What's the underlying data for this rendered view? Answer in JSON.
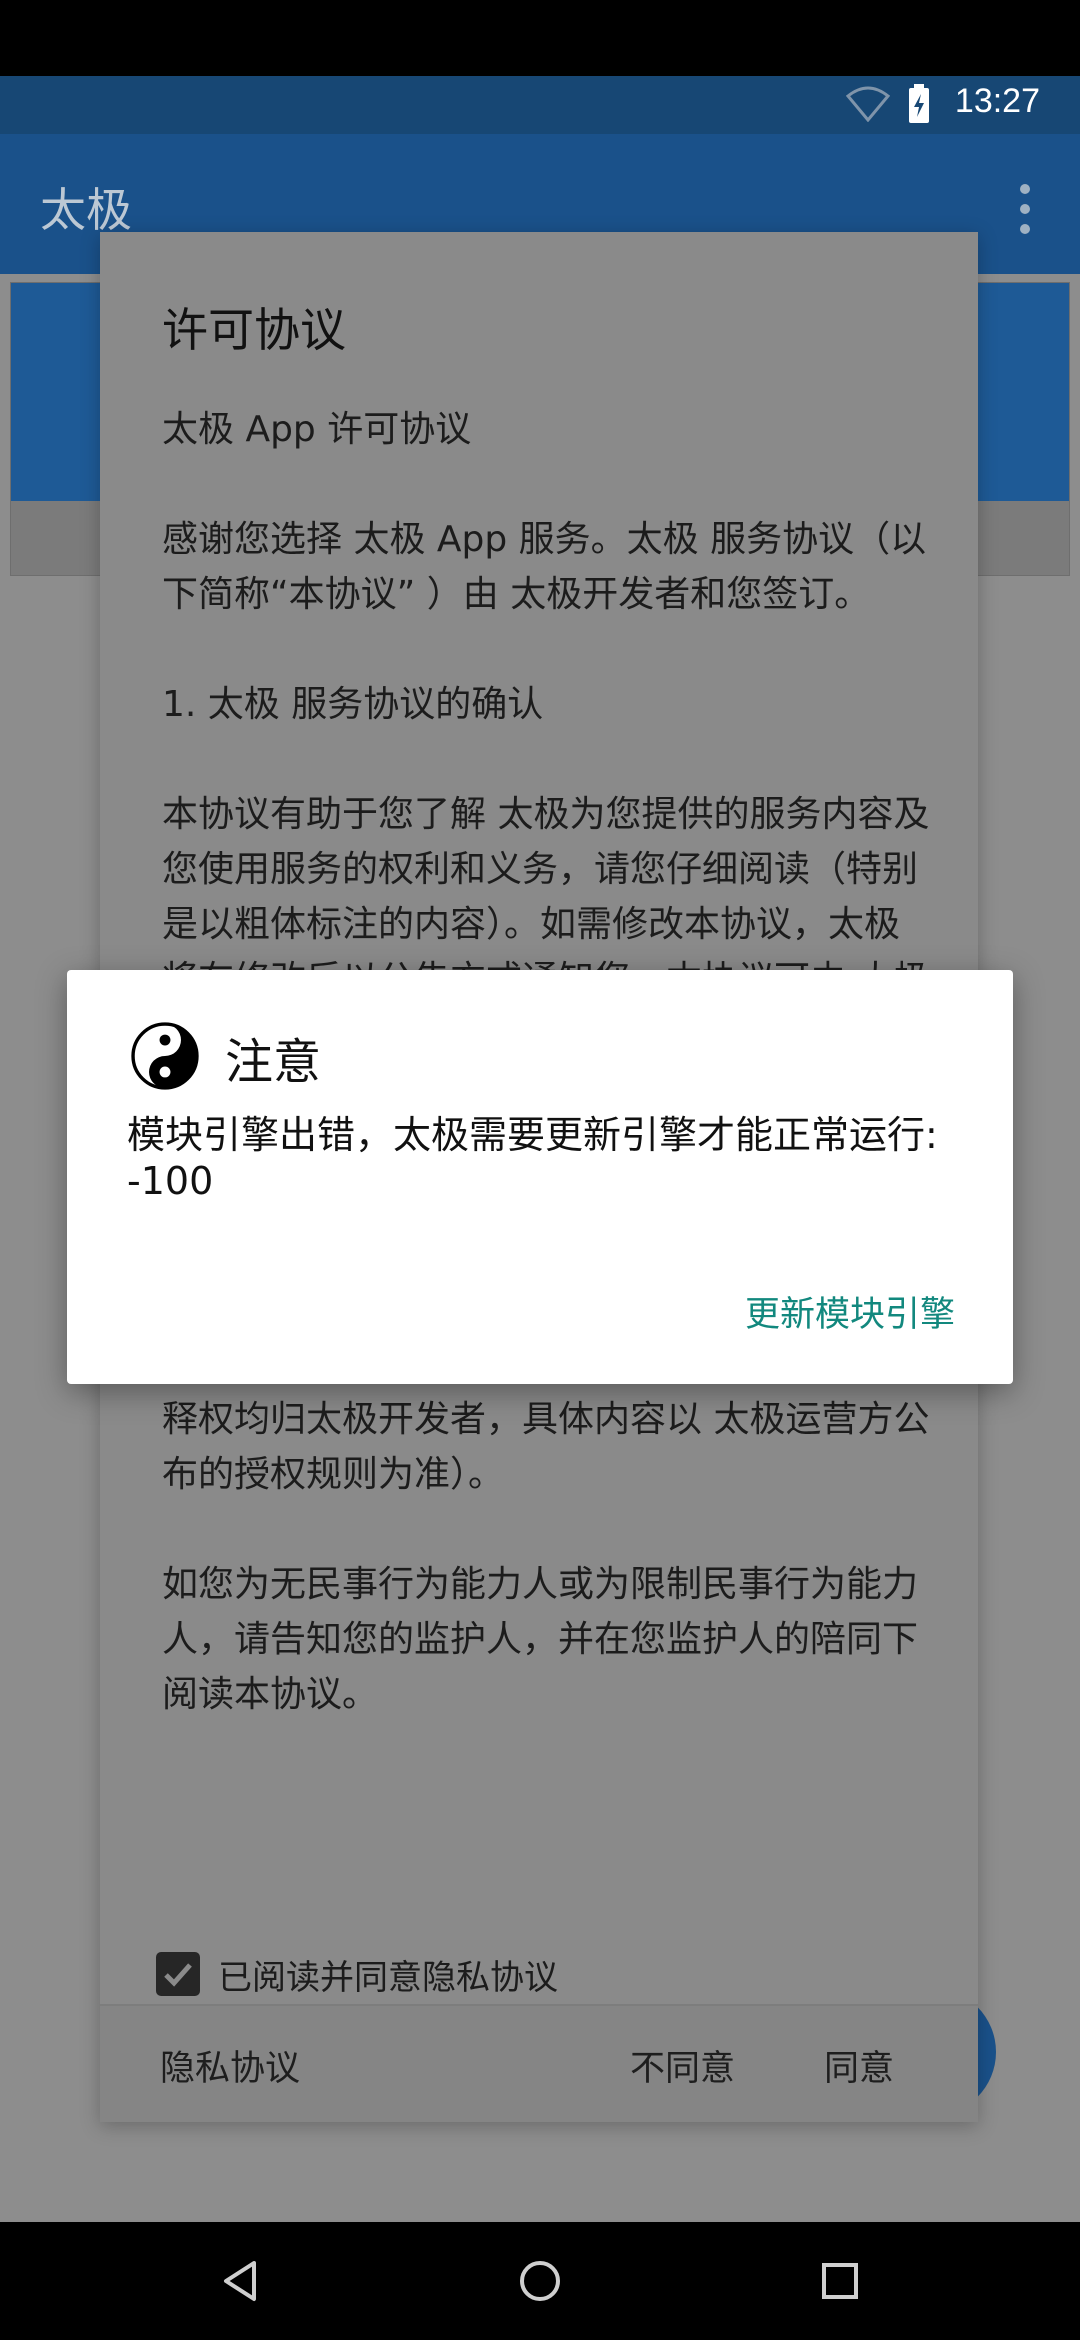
{
  "status_bar": {
    "time": "13:27",
    "icons": [
      "wifi-icon",
      "battery-charging-icon"
    ]
  },
  "app_bar": {
    "title": "太极",
    "menu_icon": "overflow-menu-icon"
  },
  "license_dialog": {
    "title": "许可协议",
    "paragraphs": [
      "太极 App 许可协议",
      "感谢您选择 太极 App 服务。太极 服务协议（以下简称“本协议” ）由 太极开发者和您签订。",
      "1. 太极 服务协议的确认",
      "本协议有助于您了解 太极为您提供的服务内容及您使用服务的权利和义务，请您仔细阅读（特别是以粗体标注的内容）。如需修改本协议，太极将在修改后以公告方式通知您。本协议可由 太极随时更新，更新后的协议条款一旦公布即代替原来的协议条款，恕不再另行通知；如太极对本协议进行修改，将通过官方网站网站公告的方式提前予以公布，变更后的协议在公告期届满起生效。若您在协议生效后继续使用 太极 服务的，表示您接受变更后的协议，也将遵循变更后的协议使用 太极 服务（授权规则的修改权及最终解释权均归太极开发者，具体内容以 太极运营方公布的授权规则为准）。",
      "如您为无民事行为能力人或为限制民事行为能力人，请告知您的监护人，并在您监护人的陪同下阅读本协议。"
    ],
    "checkbox_label": "已阅读并同意隐私协议",
    "checkbox_checked": true,
    "buttons": {
      "privacy": "隐私协议",
      "disagree": "不同意",
      "agree": "同意"
    }
  },
  "alert_dialog": {
    "icon": "yin-yang-icon",
    "title": "注意",
    "message": "模块引擎出错，太极需要更新引擎才能正常运行: -100",
    "button": "更新模块引擎",
    "button_color": "#12887e"
  },
  "nav_bar": {
    "icons": [
      "back-icon",
      "home-icon",
      "recent-apps-icon"
    ]
  }
}
